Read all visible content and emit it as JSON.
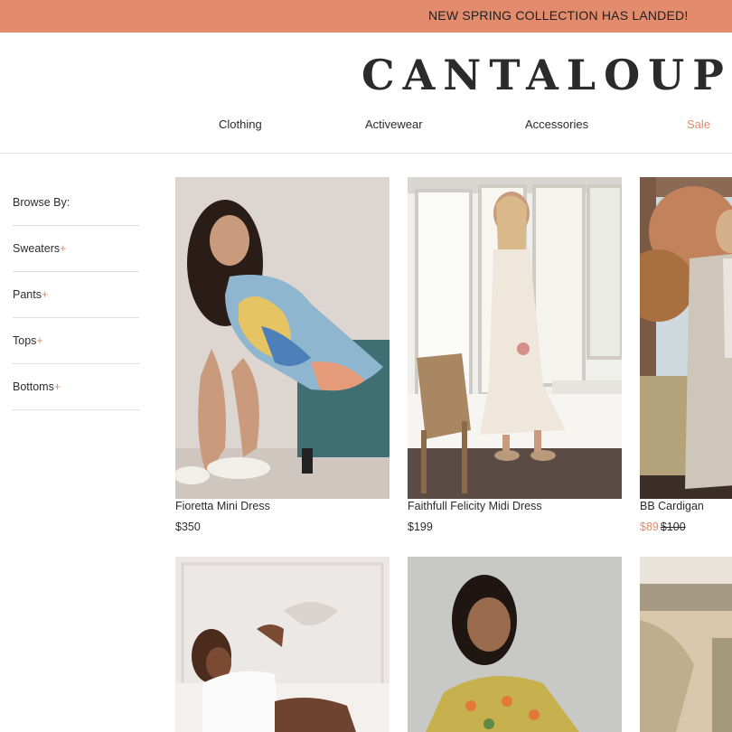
{
  "banner": {
    "text": "NEW SPRING COLLECTION HAS LANDED!"
  },
  "header": {
    "logo": "CANTALOUPE",
    "nav": [
      {
        "label": "Clothing"
      },
      {
        "label": "Activewear"
      },
      {
        "label": "Accessories"
      },
      {
        "label": "Sale"
      }
    ]
  },
  "sidebar": {
    "title": "Browse By:",
    "items": [
      {
        "label": "Sweaters",
        "icon": "+"
      },
      {
        "label": "Pants",
        "icon": "+"
      },
      {
        "label": "Tops",
        "icon": "+"
      },
      {
        "label": "Bottoms",
        "icon": "+"
      }
    ]
  },
  "products": [
    {
      "name": "Fioretta Mini Dress",
      "price": "$350"
    },
    {
      "name": "Faithfull Felicity Midi Dress",
      "price": "$199"
    },
    {
      "name": "BB Cardigan",
      "sale_price": "$89",
      "original_price": "$100"
    }
  ],
  "colors": {
    "accent": "#e38b6d",
    "text": "#2b2b2b",
    "divider": "#dedede"
  }
}
